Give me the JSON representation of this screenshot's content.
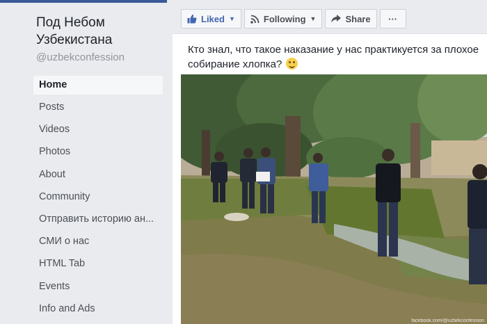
{
  "sidebar": {
    "page_name": "Под Небом Узбекистана",
    "handle": "@uzbekconfession",
    "items": [
      {
        "label": "Home"
      },
      {
        "label": "Posts"
      },
      {
        "label": "Videos"
      },
      {
        "label": "Photos"
      },
      {
        "label": "About"
      },
      {
        "label": "Community"
      },
      {
        "label": "Отправить историю ан..."
      },
      {
        "label": "СМИ о нас"
      },
      {
        "label": "HTML Tab"
      },
      {
        "label": "Events"
      },
      {
        "label": "Info and Ads"
      }
    ]
  },
  "actions": {
    "liked_label": "Liked",
    "following_label": "Following",
    "share_label": "Share",
    "more_label": "···"
  },
  "post": {
    "text": "Кто знал, что такое наказание у нас практикуется за плохое собирание хлопка?",
    "photo_watermark": "facebook.com/@uzbekconfession"
  },
  "colors": {
    "brand_blue": "#4267b2",
    "sidebar_bg": "#e9ebee",
    "text_primary": "#1d2129"
  },
  "icons": [
    "thumbs-up-icon",
    "rss-icon",
    "share-arrow-icon",
    "ellipsis-icon",
    "smiley-emoji-icon"
  ]
}
